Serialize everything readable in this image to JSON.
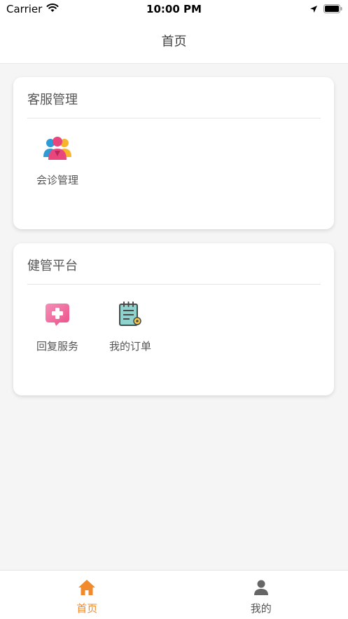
{
  "status_bar": {
    "carrier": "Carrier",
    "time": "10:00 PM",
    "icons": [
      "wifi-icon",
      "location-arrow-icon",
      "battery-icon"
    ]
  },
  "nav": {
    "title": "首页"
  },
  "sections": [
    {
      "title": "客服管理",
      "items": [
        {
          "label": "会诊管理",
          "icon": "group-consultation-icon"
        }
      ]
    },
    {
      "title": "健管平台",
      "items": [
        {
          "label": "回复服务",
          "icon": "medical-chat-icon"
        },
        {
          "label": "我的订单",
          "icon": "order-clipboard-icon"
        }
      ]
    }
  ],
  "tabs": [
    {
      "label": "首页",
      "icon": "home-icon",
      "active": true
    },
    {
      "label": "我的",
      "icon": "user-icon",
      "active": false
    }
  ],
  "colors": {
    "accent": "#f08a2c",
    "tab_inactive": "#666666",
    "background": "#f5f5f5"
  }
}
